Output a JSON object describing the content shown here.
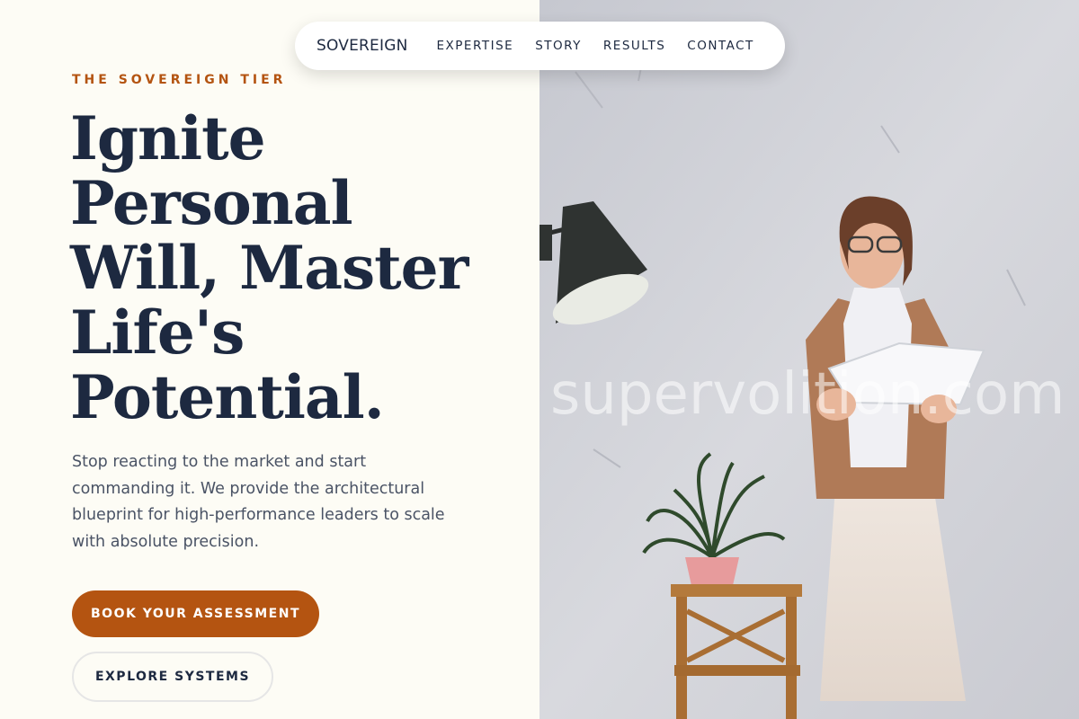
{
  "nav": {
    "brand": "SOVEREIGN",
    "links": [
      "EXPERTISE",
      "STORY",
      "RESULTS",
      "CONTACT"
    ]
  },
  "hero": {
    "eyebrow": "THE SOVEREIGN TIER",
    "headline_lines": [
      "Ignite",
      "Personal",
      "Will, Master",
      "Life's",
      "Potential."
    ],
    "lead": "Stop reacting to the market and start commanding it. We provide the architectural blueprint for high-performance leaders to scale with absolute precision.",
    "primary_cta": "BOOK YOUR ASSESSMENT",
    "secondary_cta": "EXPLORE SYSTEMS"
  },
  "image": {
    "watermark": "supervolition.com",
    "subject_icons": [
      "desk-lamp-icon",
      "potted-plant-icon",
      "wooden-stool-icon",
      "woman-with-book-photo"
    ]
  },
  "colors": {
    "accent": "#b45411",
    "navy": "#1d2940",
    "background": "#fdfcf5"
  }
}
